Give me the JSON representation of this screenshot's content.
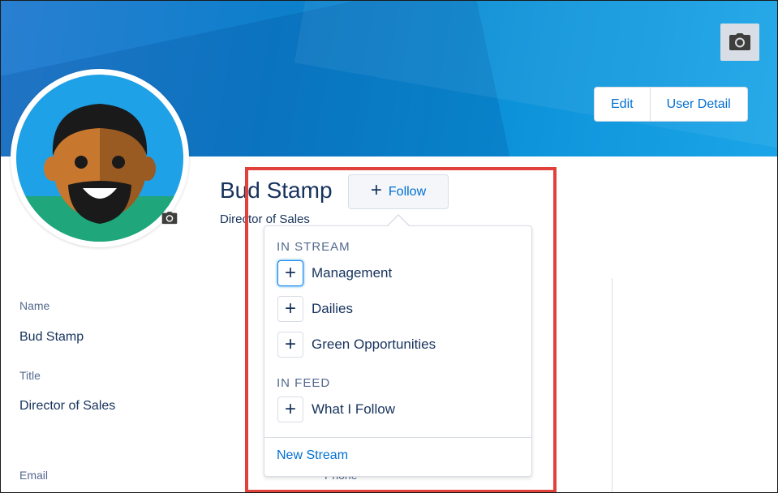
{
  "header": {
    "edit_label": "Edit",
    "user_detail_label": "User Detail",
    "banner_camera_icon": "camera-icon"
  },
  "profile": {
    "name": "Bud Stamp",
    "title": "Director of Sales",
    "avatar_camera_icon": "camera-icon"
  },
  "follow_button": {
    "icon": "plus-icon",
    "label": "Follow"
  },
  "details": {
    "name_label": "Name",
    "name_value": "Bud Stamp",
    "title_label": "Title",
    "title_value": "Director of Sales",
    "email_label": "Email",
    "phone_label": "Phone"
  },
  "follow_menu": {
    "in_stream_heading": "IN STREAM",
    "stream_items": [
      {
        "label": "Management",
        "focused": true
      },
      {
        "label": "Dailies",
        "focused": false
      },
      {
        "label": "Green Opportunities",
        "focused": false
      }
    ],
    "in_feed_heading": "IN FEED",
    "feed_items": [
      {
        "label": "What I Follow",
        "focused": false
      }
    ],
    "new_stream_label": "New Stream"
  },
  "colors": {
    "link_blue": "#0070d2",
    "text_navy": "#16325c",
    "highlight_red": "#e0423b",
    "banner_blue": "#0d7fcb"
  }
}
